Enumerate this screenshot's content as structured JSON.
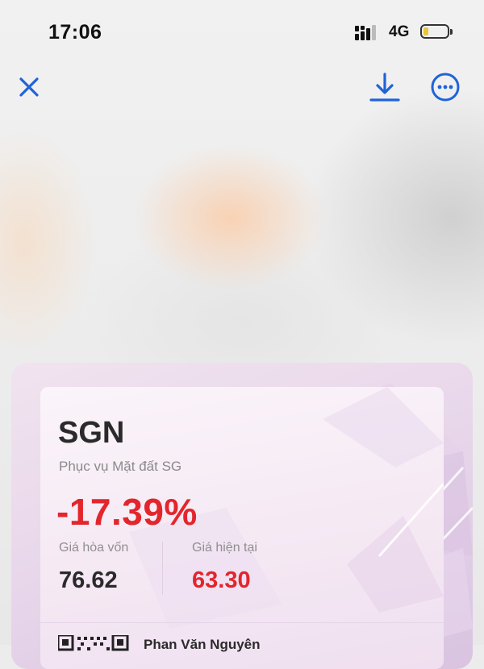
{
  "status_bar": {
    "time": "17:06",
    "network": "4G"
  },
  "toolbar": {
    "close_icon": "close-icon",
    "download_icon": "download-icon",
    "more_icon": "more-options-icon",
    "accent_color": "#1f63d8"
  },
  "card": {
    "ticker": "SGN",
    "company": "Phục vụ Mặt đất SG",
    "change": "-17.39%",
    "break_even_label": "Giá hòa vốn",
    "break_even_value": "76.62",
    "current_label": "Giá hiện tại",
    "current_value": "63.30",
    "owner_name": "Phan Văn Nguyên",
    "negative_color": "#e3252c"
  }
}
